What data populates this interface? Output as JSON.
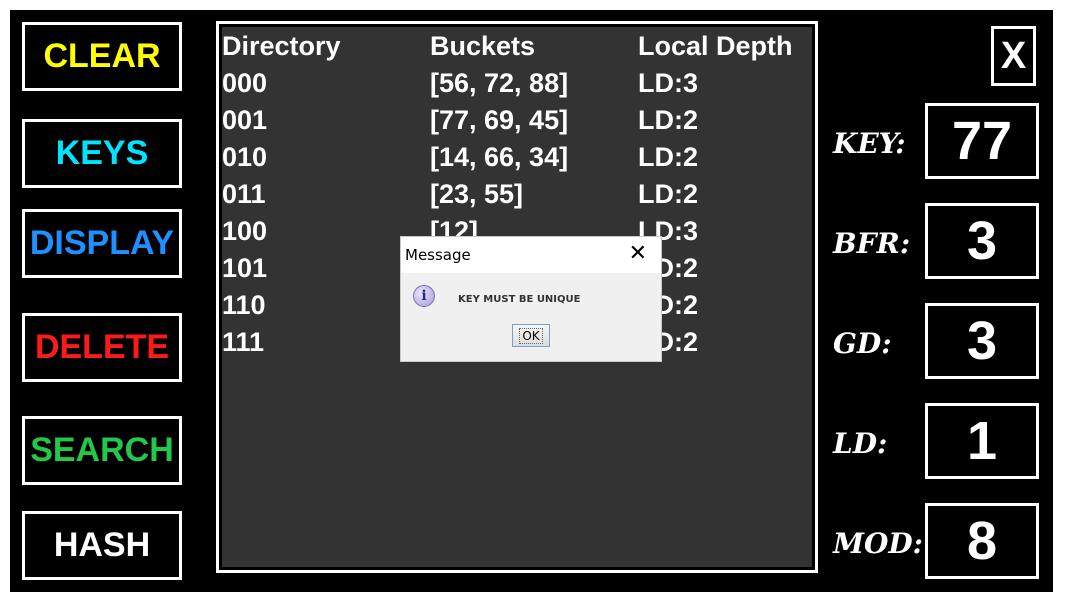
{
  "buttons": [
    {
      "label": "CLEAR",
      "color": "#ffff00"
    },
    {
      "label": "KEYS",
      "color": "#00e5ff"
    },
    {
      "label": "DISPLAY",
      "color": "#1e90ff"
    },
    {
      "label": "DELETE",
      "color": "#ff1a1a"
    },
    {
      "label": "SEARCH",
      "color": "#22c84a"
    },
    {
      "label": "HASH",
      "color": "#ffffff"
    }
  ],
  "table": {
    "headers": [
      "Directory",
      "Buckets",
      "Local Depth"
    ],
    "rows": [
      [
        "000",
        "[56, 72, 88]",
        "LD:3"
      ],
      [
        "001",
        "[77, 69, 45]",
        "LD:2"
      ],
      [
        "010",
        "[14, 66, 34]",
        "LD:2"
      ],
      [
        "011",
        "[23, 55]",
        "LD:2"
      ],
      [
        "100",
        "[12]",
        "LD:3"
      ],
      [
        "101",
        "",
        "LD:2"
      ],
      [
        "110",
        "",
        "LD:2"
      ],
      [
        "111",
        "",
        "LD:2"
      ]
    ]
  },
  "close_label": "X",
  "stats": [
    {
      "label": "KEY:",
      "value": "77"
    },
    {
      "label": "BFR:",
      "value": "3"
    },
    {
      "label": "GD:",
      "value": "3"
    },
    {
      "label": "LD:",
      "value": "1"
    },
    {
      "label": "MOD:",
      "value": "8"
    }
  ],
  "dialog": {
    "title": "Message",
    "message": "KEY MUST BE UNIQUE",
    "ok_label": "OK",
    "icon": "info-icon"
  }
}
